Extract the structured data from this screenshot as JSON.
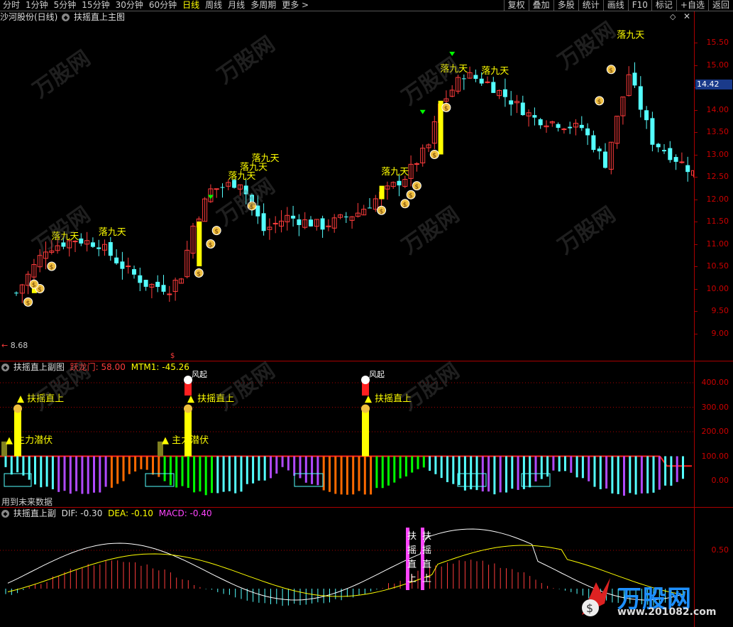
{
  "toolbar": {
    "periods": [
      "分时",
      "1分钟",
      "5分钟",
      "15分钟",
      "30分钟",
      "60分钟",
      "日线",
      "周线",
      "月线",
      "多周期",
      "更多 >"
    ],
    "active_period": "日线",
    "right_buttons": [
      "复权",
      "叠加",
      "多股",
      "统计",
      "画线",
      "F10",
      "标记",
      "+自选",
      "返回"
    ]
  },
  "main_panel": {
    "stock_name": "沙河股份(日线)",
    "indicator_name": "扶摇直上主图",
    "current_price_tag": "14.42",
    "low_price_note": "8.68",
    "signal_label": "落九天",
    "y_axis": [
      "15.50",
      "15.00",
      "14.50",
      "14.00",
      "13.50",
      "13.00",
      "12.50",
      "12.00",
      "11.50",
      "11.00",
      "10.50",
      "10.00",
      "9.50",
      "9.00"
    ]
  },
  "sub_panel": {
    "indicator_name": "扶摇直上副图",
    "value1_label": "跃龙门: 58.00",
    "value2_label": "MTM1: -45.26",
    "signal_up": "扶摇直上",
    "signal_main": "主力潜伏",
    "signal_top": "风起",
    "future_data_note": "用到未来数据",
    "y_axis": [
      "400.00",
      "300.00",
      "200.00",
      "100.00",
      "0.00"
    ]
  },
  "macd_panel": {
    "indicator_name": "扶摇直上副",
    "dif_label": "DIF: -0.30",
    "dea_label": "DEA: -0.10",
    "macd_label": "MACD: -0.40",
    "vertical_label": [
      "扶",
      "摇",
      "直",
      "上"
    ],
    "y_axis": [
      "0.50"
    ]
  },
  "watermark": {
    "brand": "万股网",
    "url": "www.201082.com"
  },
  "colors": {
    "up": "#ff3c3c",
    "down": "#54ffff",
    "signal_yellow": "#ffff00",
    "axis_red": "#cc0000",
    "purple": "#b04aff",
    "green": "#00ff00",
    "orange": "#ff6a00"
  }
}
